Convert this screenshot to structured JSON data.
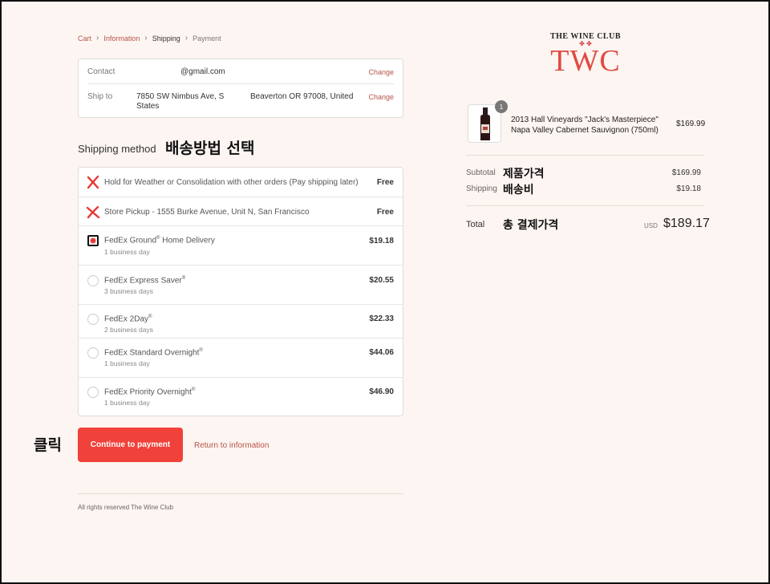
{
  "breadcrumb": {
    "cart": "Cart",
    "information": "Information",
    "shipping": "Shipping",
    "payment": "Payment"
  },
  "contact": {
    "label": "Contact",
    "value": "@gmail.com",
    "change": "Change"
  },
  "ship_to": {
    "label": "Ship to",
    "address1": "7850 SW Nimbus Ave, S",
    "address2": "States",
    "address_city": "Beaverton OR 97008, United",
    "change": "Change"
  },
  "shipping_method": {
    "title": "Shipping method",
    "annotation": "배송방법 선택",
    "options": [
      {
        "name": "Hold for Weather or Consolidation with other orders (Pay shipping later)",
        "sub": "",
        "price": "Free",
        "marked": "x"
      },
      {
        "name": "Store Pickup - 1555 Burke Avenue, Unit N, San Francisco",
        "sub": "",
        "price": "Free",
        "marked": "x"
      },
      {
        "name": "FedEx Ground",
        "sup": "®",
        "name_suffix": " Home Delivery",
        "sub": "1 business day",
        "price": "$19.18",
        "selected": true
      },
      {
        "name": "FedEx Express Saver",
        "sup": "®",
        "sub": "3 business days",
        "price": "$20.55"
      },
      {
        "name": "FedEx 2Day",
        "sup": "®",
        "sub": "2 business days",
        "price": "$22.33"
      },
      {
        "name": "FedEx Standard Overnight",
        "sup": "®",
        "sub": "1 business day",
        "price": "$44.06"
      },
      {
        "name": "FedEx Priority Overnight",
        "sup": "®",
        "sub": "1 business day",
        "price": "$46.90"
      }
    ]
  },
  "actions": {
    "click_annotation": "클릭",
    "continue": "Continue to payment",
    "return": "Return to information"
  },
  "footer": {
    "text": "All rights reserved The Wine Club"
  },
  "logo": {
    "club": "THE WINE CLUB",
    "ornament": "✤ ✤",
    "mark": "TWC"
  },
  "order": {
    "qty": "1",
    "product_line1": "2013 Hall Vineyards \"Jack's Masterpiece\"",
    "product_line2": "Napa Valley Cabernet Sauvignon (750ml)",
    "product_price": "$169.99",
    "subtotal_label": "Subtotal",
    "subtotal_annotation": "제품가격",
    "subtotal_value": "$169.99",
    "shipping_label": "Shipping",
    "shipping_annotation": "배송비",
    "shipping_value": "$19.18",
    "total_label": "Total",
    "total_annotation": "총 결제가격",
    "currency": "USD",
    "total_value": "$189.17"
  },
  "colors": {
    "accent": "#f0413a",
    "link": "#b5554a",
    "background": "#fdf5f1",
    "x_mark": "#e53935"
  }
}
